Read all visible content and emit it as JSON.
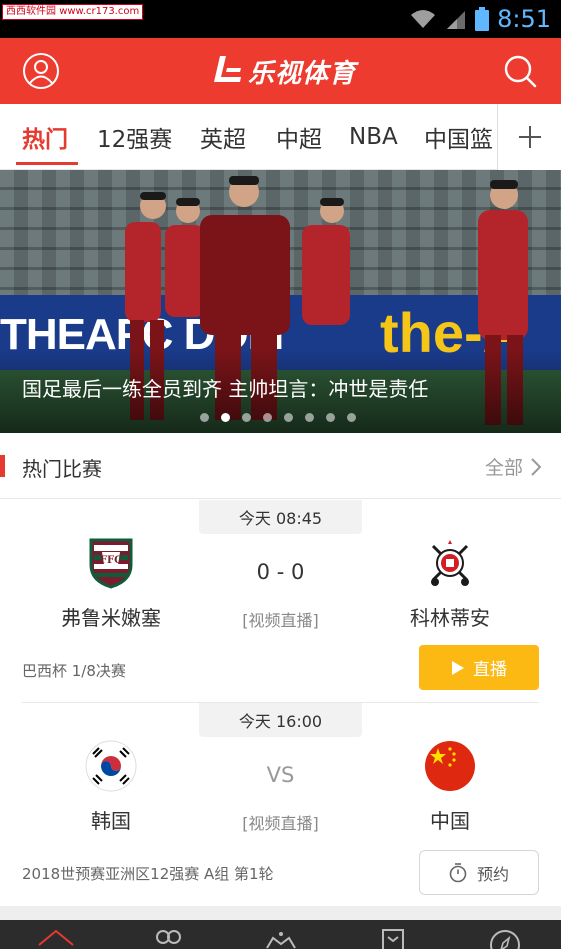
{
  "status_bar": {
    "watermark_site": "西西软件园",
    "watermark_url": "www.cr173.com",
    "time": "8:51"
  },
  "header": {
    "logo_text": "乐视体育",
    "user_icon": "user-icon",
    "search_icon": "search-icon",
    "color": "#ee3b2f"
  },
  "tabs": [
    {
      "label": "热门",
      "active": true
    },
    {
      "label": "12强赛"
    },
    {
      "label": "英超"
    },
    {
      "label": "中超"
    },
    {
      "label": "NBA"
    },
    {
      "label": "中国篮"
    }
  ],
  "banner": {
    "title": "国足最后一练全员到齐 主帅坦言：冲世是责任",
    "board_text_left": "THEAFC DOM",
    "board_text_right": "the-A",
    "slide_count": 8,
    "active_slide": 2
  },
  "section": {
    "title": "热门比赛",
    "more_label": "全部"
  },
  "matches": [
    {
      "time": "今天 08:45",
      "home": "弗鲁米嫩塞",
      "away": "科林蒂安",
      "score": "0 - 0",
      "broadcast": "[视频直播]",
      "league": "巴西杯 1/8决赛",
      "action_label": "直播"
    },
    {
      "time": "今天 16:00",
      "home": "韩国",
      "away": "中国",
      "score": "VS",
      "broadcast": "[视频直播]",
      "league": "2018世预赛亚洲区12强赛 A组 第1轮",
      "action_label": "预约"
    }
  ],
  "colors": {
    "accent": "#e53a2f",
    "live_button": "#fdb913"
  }
}
